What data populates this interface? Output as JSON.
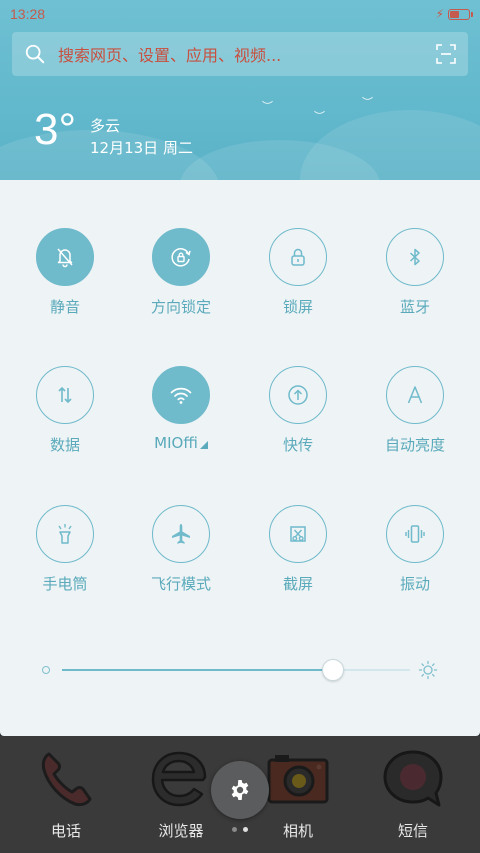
{
  "status_bar": {
    "time": "13:28",
    "battery_level": 0.5
  },
  "search": {
    "placeholder": "搜索网页、设置、应用、视频..."
  },
  "weather": {
    "temperature": "3°",
    "condition": "多云",
    "date": "12月13日 周二"
  },
  "toggles": [
    {
      "id": "mute",
      "label": "静音",
      "icon": "bell-off-icon",
      "active": true
    },
    {
      "id": "rotation-lock",
      "label": "方向锁定",
      "icon": "rotation-lock-icon",
      "active": true
    },
    {
      "id": "lock-screen",
      "label": "锁屏",
      "icon": "lock-icon",
      "active": false
    },
    {
      "id": "bluetooth",
      "label": "蓝牙",
      "icon": "bluetooth-icon",
      "active": false
    },
    {
      "id": "data",
      "label": "数据",
      "icon": "data-arrows-icon",
      "active": false
    },
    {
      "id": "wifi",
      "label": "MIOffi",
      "icon": "wifi-icon",
      "active": true
    },
    {
      "id": "quick-send",
      "label": "快传",
      "icon": "upload-icon",
      "active": false
    },
    {
      "id": "auto-brightness",
      "label": "自动亮度",
      "icon": "auto-brightness-icon",
      "active": false
    },
    {
      "id": "flashlight",
      "label": "手电筒",
      "icon": "flashlight-icon",
      "active": false
    },
    {
      "id": "airplane",
      "label": "飞行模式",
      "icon": "airplane-icon",
      "active": false
    },
    {
      "id": "screenshot",
      "label": "截屏",
      "icon": "scissors-icon",
      "active": false
    },
    {
      "id": "vibrate",
      "label": "振动",
      "icon": "vibrate-icon",
      "active": false
    }
  ],
  "brightness": {
    "level": 0.78
  },
  "dock": [
    {
      "label": "电话",
      "icon": "phone-icon"
    },
    {
      "label": "浏览器",
      "icon": "browser-icon"
    },
    {
      "label": "相机",
      "icon": "camera-icon"
    },
    {
      "label": "短信",
      "icon": "message-icon"
    }
  ],
  "page_indicator": {
    "count": 2,
    "current": 1
  },
  "colors": {
    "accent": "#6fbacb",
    "header": "#62b8cc",
    "panel_bg": "#eef3f5",
    "search_text": "#c8503f",
    "status": "#c55b4f"
  }
}
